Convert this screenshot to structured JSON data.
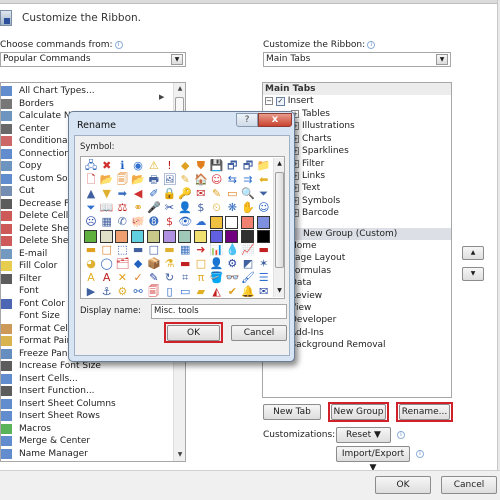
{
  "header": {
    "title": "Customize the Ribbon."
  },
  "left": {
    "label": "Choose commands from:",
    "combo_value": "Popular Commands",
    "commands": [
      {
        "label": "All Chart Types...",
        "icon": "chart-icon"
      },
      {
        "label": "Borders",
        "icon": "borders-icon"
      },
      {
        "label": "Calculate Now",
        "icon": "calculator-icon"
      },
      {
        "label": "Center",
        "icon": "align-center-icon"
      },
      {
        "label": "Conditional Formatting",
        "icon": "conditional-format-icon"
      },
      {
        "label": "Connections",
        "icon": "connections-icon"
      },
      {
        "label": "Copy",
        "icon": "copy-icon"
      },
      {
        "label": "Custom Sort...",
        "icon": "sort-icon"
      },
      {
        "label": "Cut",
        "icon": "scissors-icon"
      },
      {
        "label": "Decrease Font Size",
        "icon": "decrease-font-icon"
      },
      {
        "label": "Delete Cells...",
        "icon": "delete-cells-icon"
      },
      {
        "label": "Delete Sheet Columns",
        "icon": "delete-columns-icon"
      },
      {
        "label": "Delete Sheet Rows",
        "icon": "delete-rows-icon"
      },
      {
        "label": "E-mail",
        "icon": "email-icon"
      },
      {
        "label": "Fill Color",
        "icon": "fill-color-icon"
      },
      {
        "label": "Filter",
        "icon": "filter-icon"
      },
      {
        "label": "Font",
        "icon": "font-icon"
      },
      {
        "label": "Font Color",
        "icon": "font-color-icon"
      },
      {
        "label": "Font Size",
        "icon": "font-size-icon"
      },
      {
        "label": "Format Cells",
        "icon": "format-cells-icon"
      },
      {
        "label": "Format Painter",
        "icon": "format-painter-icon"
      },
      {
        "label": "Freeze Panes",
        "icon": "freeze-panes-icon"
      },
      {
        "label": "Increase Font Size",
        "icon": "increase-font-icon"
      },
      {
        "label": "Insert Cells...",
        "icon": "insert-cells-icon"
      },
      {
        "label": "Insert Function...",
        "icon": "function-icon"
      },
      {
        "label": "Insert Sheet Columns",
        "icon": "insert-columns-icon"
      },
      {
        "label": "Insert Sheet Rows",
        "icon": "insert-rows-icon"
      },
      {
        "label": "Macros",
        "icon": "macros-icon"
      },
      {
        "label": "Merge & Center",
        "icon": "merge-center-icon"
      },
      {
        "label": "Name Manager",
        "icon": "name-manager-icon"
      }
    ]
  },
  "right": {
    "label": "Customize the Ribbon:",
    "combo_value": "Main Tabs",
    "tree_header": "Main Tabs",
    "insert_tab": "Insert",
    "insert_checked": true,
    "groups": [
      "Tables",
      "Illustrations",
      "Charts",
      "Sparklines",
      "Filter",
      "Links",
      "Text",
      "Symbols",
      "Barcode"
    ],
    "new_group": "New Group (Custom)",
    "tabs": [
      "Home",
      "Page Layout",
      "Formulas",
      "Data",
      "Review",
      "View",
      "Developer",
      "Add-Ins",
      "Background Removal"
    ],
    "buttons": {
      "new_tab": "New Tab",
      "new_group": "New Group",
      "rename": "Rename..."
    },
    "customizations_label": "Customizations:",
    "reset": "Reset ▼",
    "import_export": "Import/Export ▼",
    "move_up": "▲",
    "move_down": "▼"
  },
  "footer": {
    "ok": "OK",
    "cancel": "Cancel"
  },
  "dialog": {
    "title": "Rename",
    "help": "?",
    "close": "x",
    "symbol_label": "Symbol:",
    "display_name_label": "Display name:",
    "display_name_value": "Misc. tools",
    "ok": "OK",
    "cancel": "Cancel",
    "symbols": [
      [
        "🖧",
        "✖",
        "ℹ",
        "◉",
        "⚠",
        "!",
        "◆",
        "⛊",
        "💾",
        "🗗",
        "🗗",
        "📁"
      ],
      [
        "🗋",
        "📂",
        "🗐",
        "📂",
        "🖶",
        "🖼",
        "✎",
        "🏠",
        "☺",
        "⇆",
        "⇉",
        "⬅"
      ],
      [
        "▲",
        "▼",
        "➡",
        "◀",
        "✐",
        "🔒",
        "🔑",
        "✉",
        "✎",
        "▭",
        "🔍",
        "⏷"
      ],
      [
        "⏷",
        "📖",
        "⚖",
        "⚭",
        "🎤",
        "✂",
        "👤",
        "$",
        "⏲",
        "❋",
        "✋",
        "☺"
      ],
      [
        "☹",
        "▦",
        "✆",
        "🐖",
        "➑",
        "$",
        "👁",
        "☁",
        "▦",
        "□",
        "■",
        "■"
      ],
      [
        "■",
        "■",
        "■",
        "■",
        "■",
        "■",
        "■",
        "■",
        "■",
        "■",
        "◩",
        "■"
      ],
      [
        "▬",
        "□",
        "⬚",
        "▬",
        "□",
        "▬",
        "▦",
        "➜",
        "📊",
        "💧",
        "📈",
        "▬"
      ],
      [
        "◕",
        "◯",
        "🗂",
        "◆",
        "📦",
        "⚗",
        "▬",
        "□",
        "👤",
        "⚙",
        "◩",
        "✶"
      ],
      [
        "A",
        "A",
        "✕",
        "✓",
        "✎",
        "↻",
        "⌗",
        "π",
        "🪣",
        "👓",
        "🖌",
        "☰"
      ],
      [
        "▶",
        "⚓",
        "⚙",
        "⚯",
        "🗐",
        "▯",
        "▭",
        "▰",
        "◭",
        "✔",
        "🔔",
        "✉"
      ]
    ],
    "swatches": {
      "row4": [
        "#f0c040",
        "#ffffff",
        "#f08070",
        "#8090e0"
      ],
      "row5": [
        "#60b040",
        "#e0e0c8",
        "#f0a070",
        "#60d0e0",
        "#c8c888",
        "#b090e0",
        "#a0c8b8",
        "#f0e070",
        "#6060e0",
        "#700080",
        "#303030",
        "#000000"
      ]
    }
  }
}
